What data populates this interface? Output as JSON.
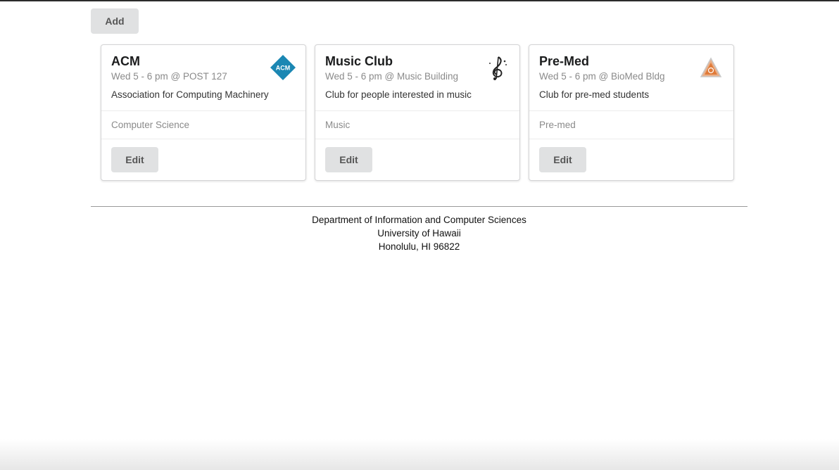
{
  "toolbar": {
    "add_label": "Add"
  },
  "clubs": [
    {
      "title": "ACM",
      "meta": "Wed 5 - 6 pm @ POST 127",
      "description": "Association for Computing Machinery",
      "category": "Computer Science",
      "edit_label": "Edit",
      "logo": {
        "icon": "acm-logo-icon",
        "text": "ACM",
        "color": "#1b87b3"
      }
    },
    {
      "title": "Music Club",
      "meta": "Wed 5 - 6 pm @ Music Building",
      "description": "Club for people interested in music",
      "category": "Music",
      "edit_label": "Edit",
      "logo": {
        "icon": "treble-clef-icon"
      }
    },
    {
      "title": "Pre-Med",
      "meta": "Wed 5 - 6 pm @ BioMed Bldg",
      "description": "Club for pre-med students",
      "category": "Pre-med",
      "edit_label": "Edit",
      "logo": {
        "icon": "premed-triangle-logo-icon",
        "color": "#e07b39"
      }
    }
  ],
  "footer": {
    "line1": "Department of Information and Computer Sciences",
    "line2": "University of Hawaii",
    "line3": "Honolulu, HI 96822"
  }
}
